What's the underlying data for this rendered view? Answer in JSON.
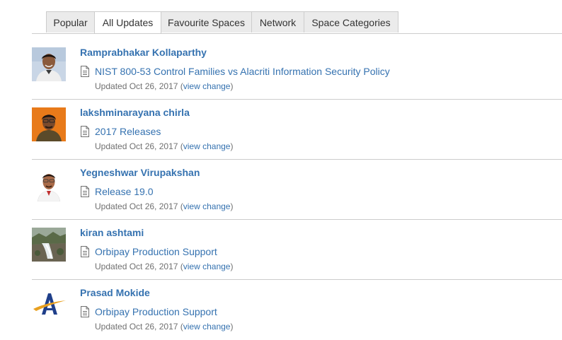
{
  "tabs": [
    {
      "label": "Popular",
      "active": false
    },
    {
      "label": "All Updates",
      "active": true
    },
    {
      "label": "Favourite Spaces",
      "active": false
    },
    {
      "label": "Network",
      "active": false
    },
    {
      "label": "Space Categories",
      "active": false
    }
  ],
  "entries": [
    {
      "user": "Ramprabhakar Kollaparthy",
      "avatar": "person-photo-avatar",
      "page_icon": "page-icon",
      "page_title": "NIST 800-53 Control Families vs Alacriti Information Security Policy",
      "updated_prefix": "Updated Oct 26, 2017 (",
      "view_change": "view change",
      "updated_suffix": ")"
    },
    {
      "user": "lakshminarayana chirla",
      "avatar": "person-photo-avatar",
      "page_icon": "page-icon",
      "page_title": "2017 Releases",
      "updated_prefix": "Updated Oct 26, 2017 (",
      "view_change": "view change",
      "updated_suffix": ")"
    },
    {
      "user": "Yegneshwar Virupakshan",
      "avatar": "person-photo-avatar",
      "page_icon": "page-icon",
      "page_title": "Release 19.0",
      "updated_prefix": "Updated Oct 26, 2017 (",
      "view_change": "view change",
      "updated_suffix": ")"
    },
    {
      "user": "kiran ashtami",
      "avatar": "landscape-photo-avatar",
      "page_icon": "page-icon",
      "page_title": "Orbipay Production Support",
      "updated_prefix": "Updated Oct 26, 2017 (",
      "view_change": "view change",
      "updated_suffix": ")"
    },
    {
      "user": "Prasad Mokide",
      "avatar": "alacriti-logo-avatar",
      "page_icon": "page-icon",
      "page_title": "Orbipay Production Support",
      "updated_prefix": "Updated Oct 26, 2017 (",
      "view_change": "view change",
      "updated_suffix": ")"
    }
  ],
  "colors": {
    "link": "#3572b0",
    "meta_text": "#707070",
    "tab_bg": "#ebebeb",
    "border": "#cccccc"
  }
}
